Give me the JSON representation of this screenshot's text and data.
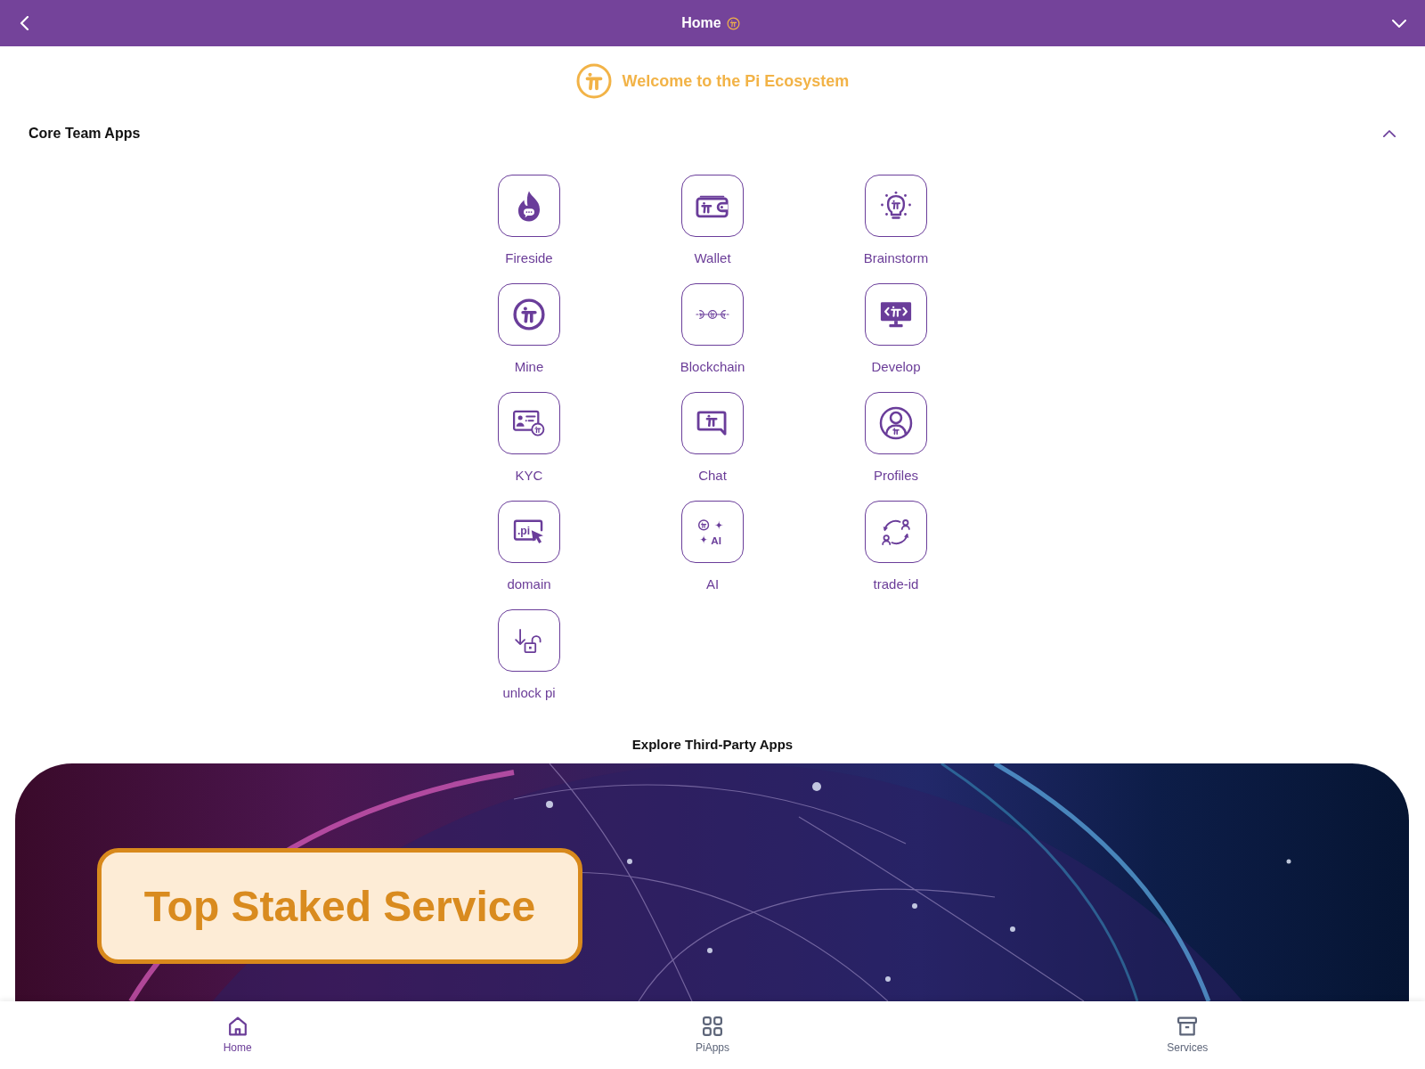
{
  "header": {
    "title": "Home"
  },
  "welcome": {
    "text": "Welcome to the Pi Ecosystem"
  },
  "core_apps": {
    "title": "Core Team Apps",
    "expanded": true,
    "apps": [
      {
        "label": "Fireside",
        "kind": "fireside"
      },
      {
        "label": "Wallet",
        "kind": "wallet"
      },
      {
        "label": "Brainstorm",
        "kind": "brainstorm"
      },
      {
        "label": "Mine",
        "kind": "mine"
      },
      {
        "label": "Blockchain",
        "kind": "blockchain"
      },
      {
        "label": "Develop",
        "kind": "develop"
      },
      {
        "label": "KYC",
        "kind": "kyc"
      },
      {
        "label": "Chat",
        "kind": "chat"
      },
      {
        "label": "Profiles",
        "kind": "profiles"
      },
      {
        "label": "domain",
        "kind": "domain",
        "icon_text": ".pi"
      },
      {
        "label": "AI",
        "kind": "ai",
        "icon_text": "AI"
      },
      {
        "label": "trade-id",
        "kind": "trade"
      },
      {
        "label": "unlock pi",
        "kind": "unlock"
      }
    ]
  },
  "third_party": {
    "title": "Explore Third-Party Apps",
    "banner": {
      "label": "Top Staked Service"
    }
  },
  "bottom_nav": [
    {
      "label": "Home",
      "kind": "home",
      "selected": true
    },
    {
      "label": "PiApps",
      "kind": "apps",
      "selected": false
    },
    {
      "label": "Services",
      "kind": "services",
      "selected": false
    }
  ]
}
